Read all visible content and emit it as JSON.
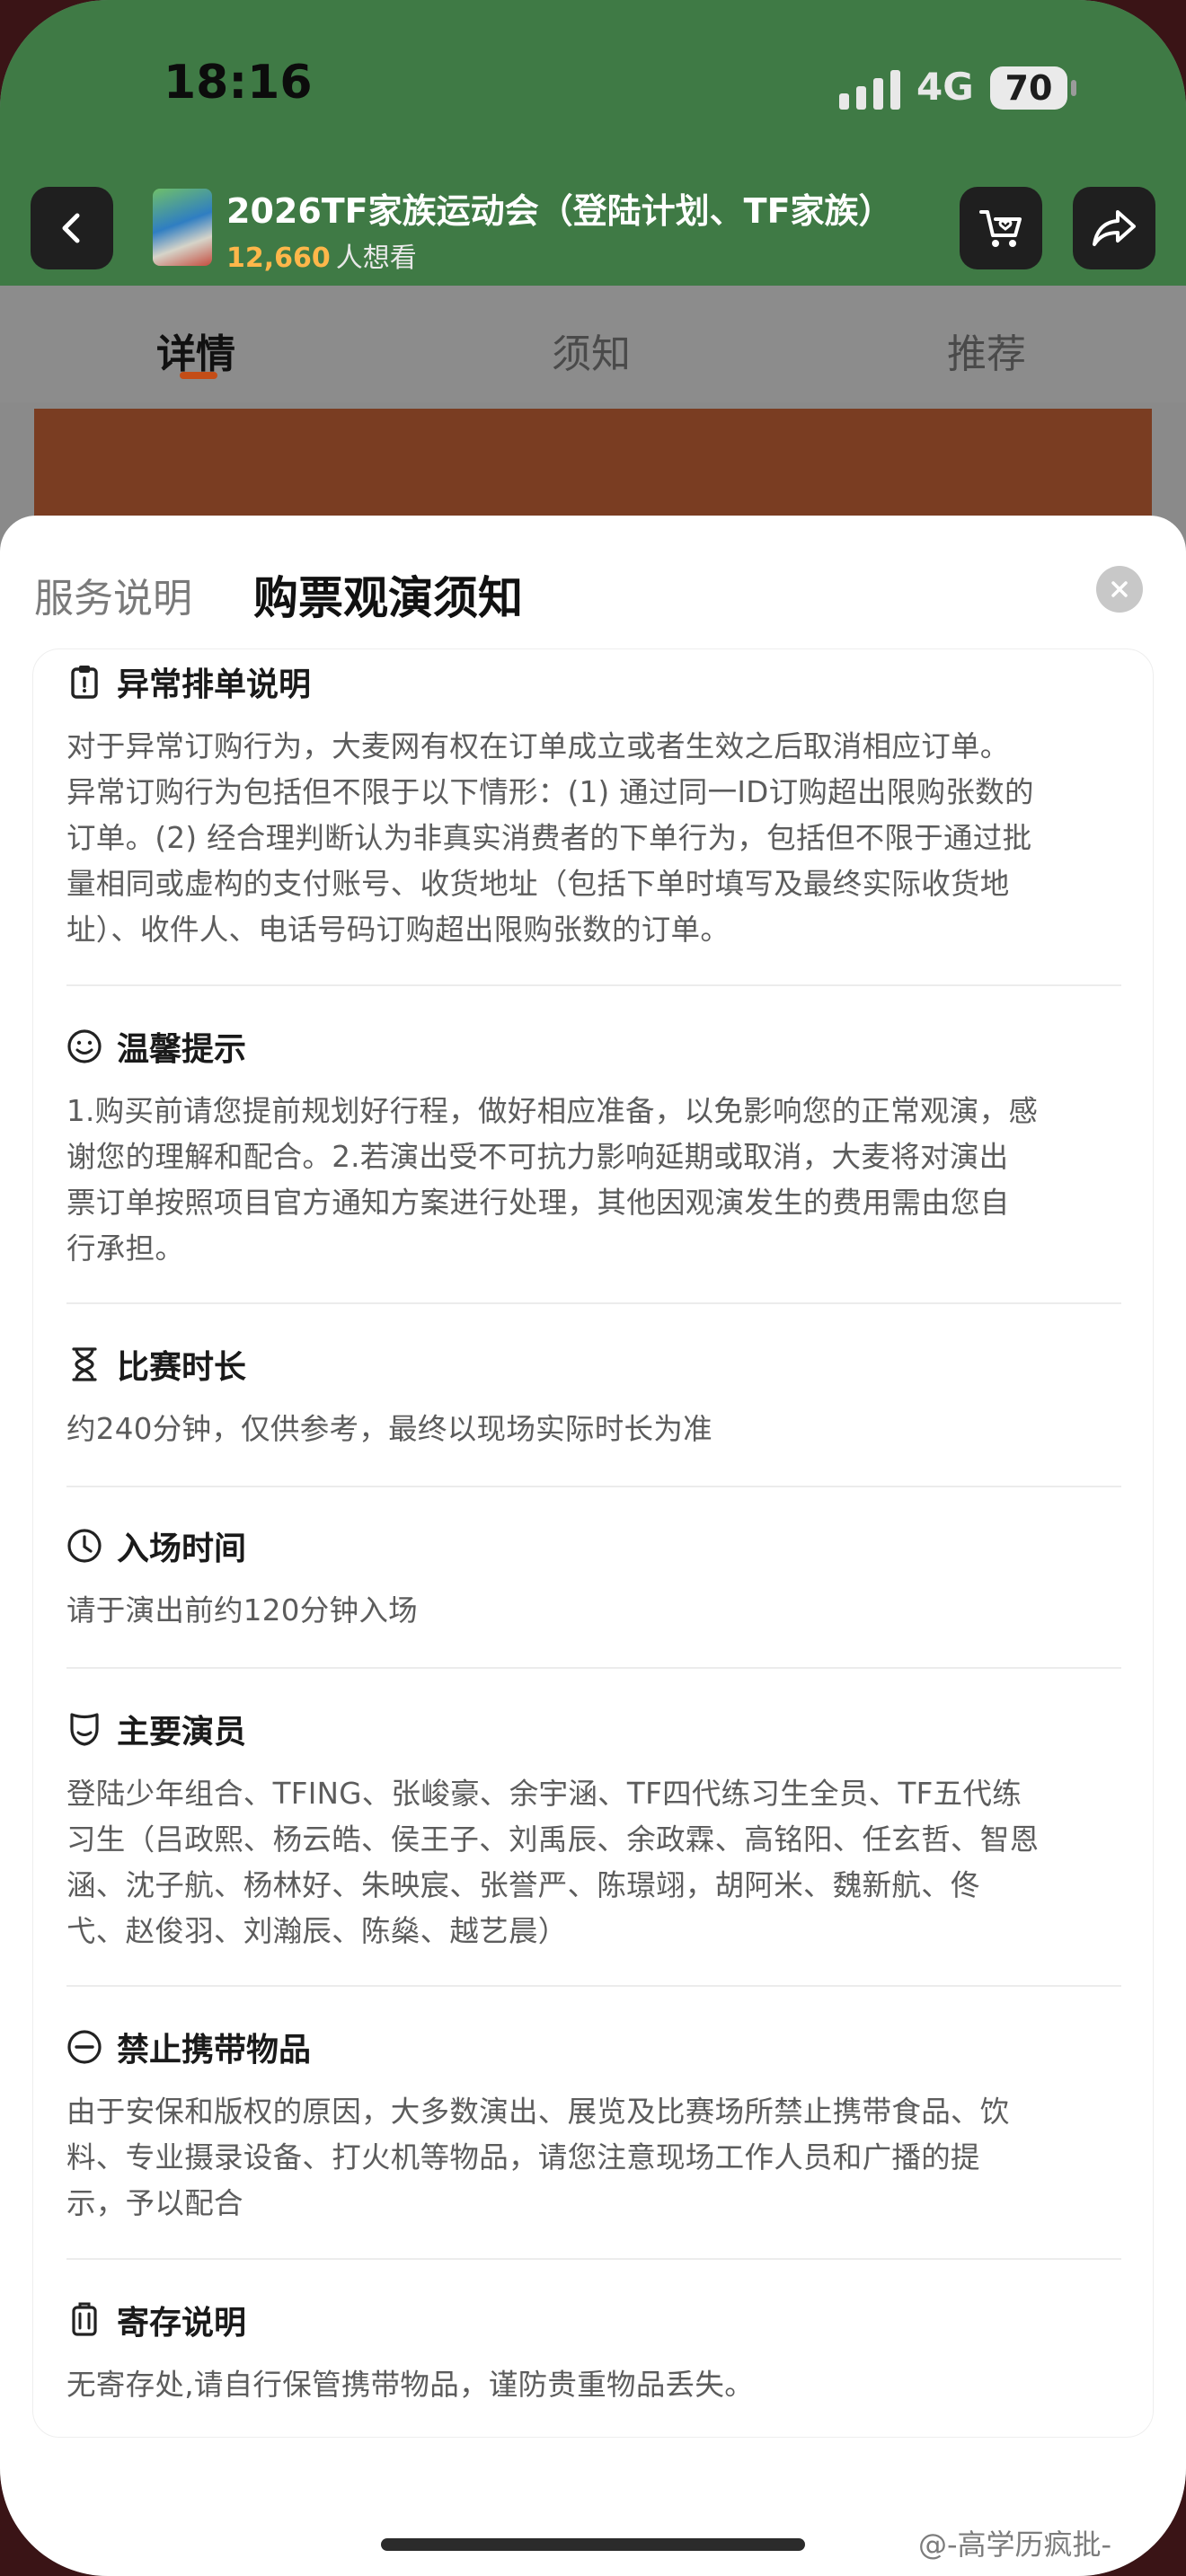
{
  "status_bar": {
    "time": "18:16",
    "network": "4G",
    "battery": "70"
  },
  "header": {
    "title": "2026TF家族运动会（登陆计划、TF家族）",
    "want_count": "12,660",
    "want_label": "人想看"
  },
  "tabs": [
    {
      "label": "详情",
      "active": true
    },
    {
      "label": "须知",
      "active": false
    },
    {
      "label": "推荐",
      "active": false
    }
  ],
  "sheet": {
    "tabs": [
      {
        "label": "服务说明",
        "active": false
      },
      {
        "label": "购票观演须知",
        "active": true
      }
    ],
    "sections": [
      {
        "icon": "clipboard-icon",
        "title": "异常排单说明",
        "lines": [
          "对于异常订购行为，大麦网有权在订单成立或者生效之后取消相应订单。",
          "异常订购行为包括但不限于以下情形：(1) 通过同一ID订购超出限购张数的",
          "订单。(2) 经合理判断认为非真实消费者的下单行为，包括但不限于通过批",
          "量相同或虚构的支付账号、收货地址（包括下单时填写及最终实际收货地",
          "址）、收件人、电话号码订购超出限购张数的订单。"
        ]
      },
      {
        "icon": "smile-icon",
        "title": "温馨提示",
        "lines": [
          "1.购买前请您提前规划好行程，做好相应准备，以免影响您的正常观演，感",
          "谢您的理解和配合。2.若演出受不可抗力影响延期或取消，大麦将对演出",
          "票订单按照项目官方通知方案进行处理，其他因观演发生的费用需由您自",
          "行承担。"
        ]
      },
      {
        "icon": "hourglass-icon",
        "title": "比赛时长",
        "lines": [
          "约240分钟，仅供参考，最终以现场实际时长为准"
        ]
      },
      {
        "icon": "clock-icon",
        "title": "入场时间",
        "lines": [
          "请于演出前约120分钟入场"
        ]
      },
      {
        "icon": "mask-icon",
        "title": "主要演员",
        "lines": [
          "登陆少年组合、TFING、张峻豪、余宇涵、TF四代练习生全员、TF五代练",
          "习生（吕政熙、杨云皓、侯王子、刘禹辰、余政霖、高铭阳、任玄哲、智恩",
          "涵、沈子航、杨林好、朱映宸、张誉严、陈璟翊，胡阿米、魏新航、佟",
          "弋、赵俊羽、刘瀚辰、陈燊、越艺晨）"
        ]
      },
      {
        "icon": "no-entry-icon",
        "title": "禁止携带物品",
        "lines": [
          "由于安保和版权的原因，大多数演出、展览及比赛场所禁止携带食品、饮",
          "料、专业摄录设备、打火机等物品，请您注意现场工作人员和广播的提",
          "示，予以配合"
        ]
      },
      {
        "icon": "locker-icon",
        "title": "寄存说明",
        "lines": [
          "无寄存处,请自行保管携带物品，谨防贵重物品丢失。"
        ]
      }
    ]
  },
  "watermark": "@-高学历疯批-"
}
